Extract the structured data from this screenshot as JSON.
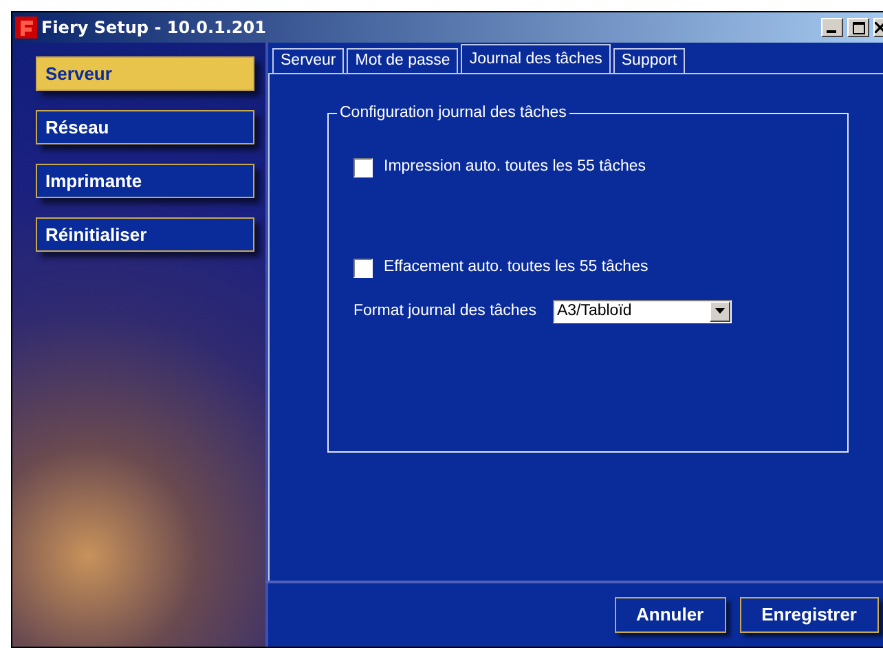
{
  "window": {
    "title": "Fiery Setup - 10.0.1.201"
  },
  "tabs": [
    {
      "label": "Serveur",
      "selected": false
    },
    {
      "label": "Mot de passe",
      "selected": false
    },
    {
      "label": "Journal des tâches",
      "selected": true
    },
    {
      "label": "Support",
      "selected": false
    }
  ],
  "sidebar": {
    "items": [
      {
        "label": "Serveur",
        "selected": true
      },
      {
        "label": "Réseau",
        "selected": false
      },
      {
        "label": "Imprimante",
        "selected": false
      },
      {
        "label": "Réinitialiser",
        "selected": false
      }
    ]
  },
  "group": {
    "title": "Configuration journal des tâches",
    "checkboxes": [
      {
        "label": "Impression auto. toutes les 55 tâches",
        "checked": false
      },
      {
        "label": "Effacement auto. toutes les 55 tâches",
        "checked": false
      }
    ],
    "format": {
      "label": "Format journal des tâches",
      "value": "A3/Tabloïd"
    }
  },
  "buttons": [
    {
      "label": "Annuler"
    },
    {
      "label": "Enregistrer"
    }
  ]
}
